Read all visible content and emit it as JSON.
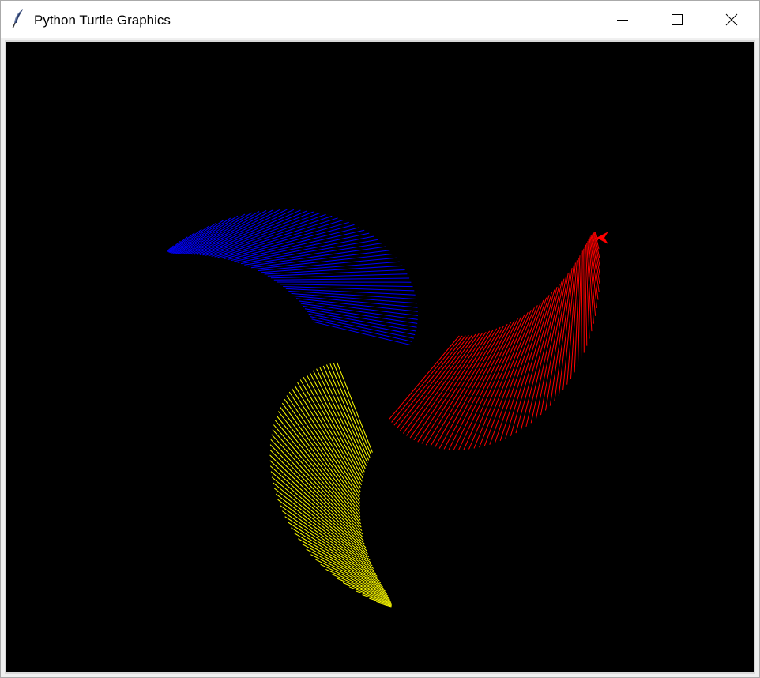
{
  "window": {
    "title": "Python Turtle Graphics",
    "icon": "feather-icon",
    "controls": {
      "minimize": "minimize-icon",
      "maximize": "maximize-icon",
      "close": "close-icon"
    }
  },
  "canvas": {
    "background": "#000000",
    "pen_colors": [
      "#ff0000",
      "#0000ff",
      "#ffff00"
    ],
    "turtle_color": "#ff0000",
    "turtle_shape": "classic-arrow-icon"
  }
}
